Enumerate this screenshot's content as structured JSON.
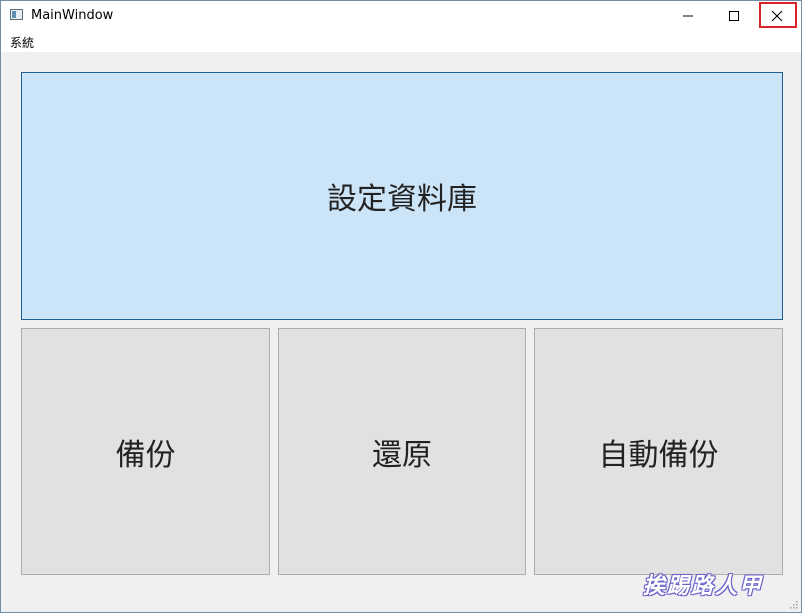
{
  "window": {
    "title": "MainWindow",
    "controls": {
      "minimize": "minimize-icon",
      "maximize": "maximize-icon",
      "close": "close-icon"
    },
    "close_highlight_color": "#d9242b"
  },
  "menubar": {
    "items": [
      {
        "label": "系統"
      }
    ]
  },
  "main": {
    "set_database_label": "設定資料庫",
    "backup_label": "備份",
    "restore_label": "還原",
    "auto_backup_label": "自動備份"
  },
  "colors": {
    "primary_button_bg": "#cce4f7",
    "primary_button_border": "#1e5f97",
    "button_bg": "#e1e1e1",
    "button_border": "#adadad",
    "client_bg": "#f0f0f0"
  },
  "watermark": {
    "text": "挨踢路人甲"
  }
}
